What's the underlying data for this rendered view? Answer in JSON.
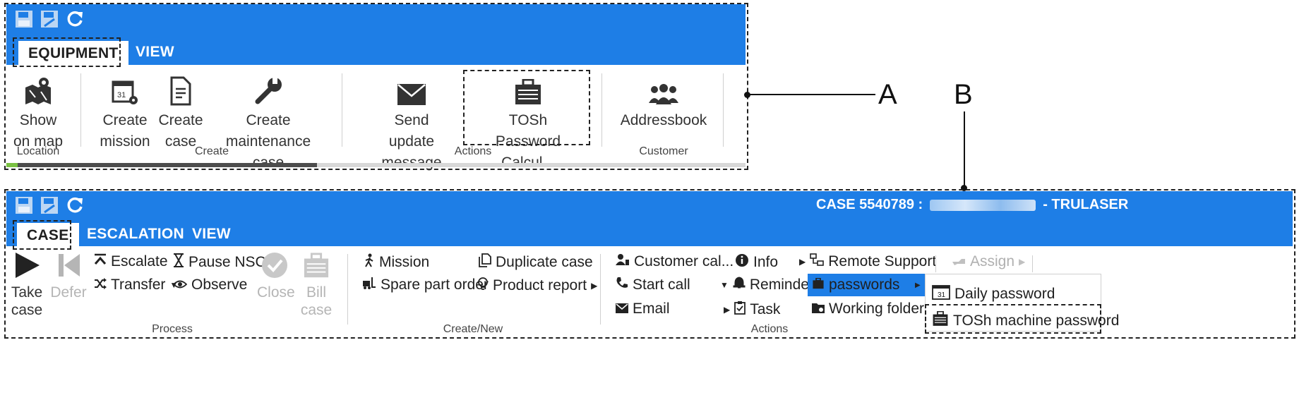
{
  "top_ribbon": {
    "tabs": [
      {
        "label": "EQUIPMENT",
        "active": true
      },
      {
        "label": "VIEW",
        "active": false
      }
    ],
    "buttons": {
      "show_on_map": [
        "Show",
        "on map"
      ],
      "create_mission": [
        "Create",
        "mission"
      ],
      "create_case": [
        "Create",
        "case"
      ],
      "create_maintenance": [
        "Create",
        "maintenance case"
      ],
      "send_update": [
        "Send",
        "update message"
      ],
      "tosh_password": [
        "TOSh",
        "Password Calcul..."
      ],
      "addressbook": [
        "Addressbook"
      ]
    },
    "groups": {
      "location": "Location",
      "create": "Create",
      "actions": "Actions",
      "customer": "Customer"
    }
  },
  "bottom_ribbon": {
    "title": "CASE 5540789 :",
    "title_suffix": "- TRULASER",
    "tabs": [
      {
        "label": "CASE",
        "active": true
      },
      {
        "label": "ESCALATION",
        "active": false
      },
      {
        "label": "VIEW",
        "active": false
      }
    ],
    "process": {
      "take_case": [
        "Take",
        "case"
      ],
      "defer": [
        "Defer"
      ],
      "escalate": "Escalate",
      "pause_nsc": "Pause NSC",
      "transfer": "Transfer",
      "observe": "Observe",
      "close": [
        "Close"
      ],
      "bill_case": [
        "Bill",
        "case"
      ]
    },
    "create_new": {
      "mission": "Mission",
      "duplicate_case": "Duplicate case",
      "spare_part_order": "Spare part order",
      "product_report": "Product report"
    },
    "actions": {
      "customer_call": "Customer cal...",
      "info": "Info",
      "remote_support": "Remote Support",
      "assign": "Assign",
      "start_call": "Start call",
      "reminder": "Reminder",
      "passwords": "passwords",
      "email": "Email",
      "task": "Task",
      "working_folder": "Working folder"
    },
    "submenu": {
      "daily_password": "Daily password",
      "tosh_machine_password": "TOSh machine password"
    },
    "groups": {
      "process": "Process",
      "create_new": "Create/New",
      "actions": "Actions"
    }
  },
  "callouts": {
    "a": "A",
    "b": "B"
  },
  "colors": {
    "ribbon_blue": "#1e7ee6",
    "highlight_blue": "#1e7ee6"
  }
}
